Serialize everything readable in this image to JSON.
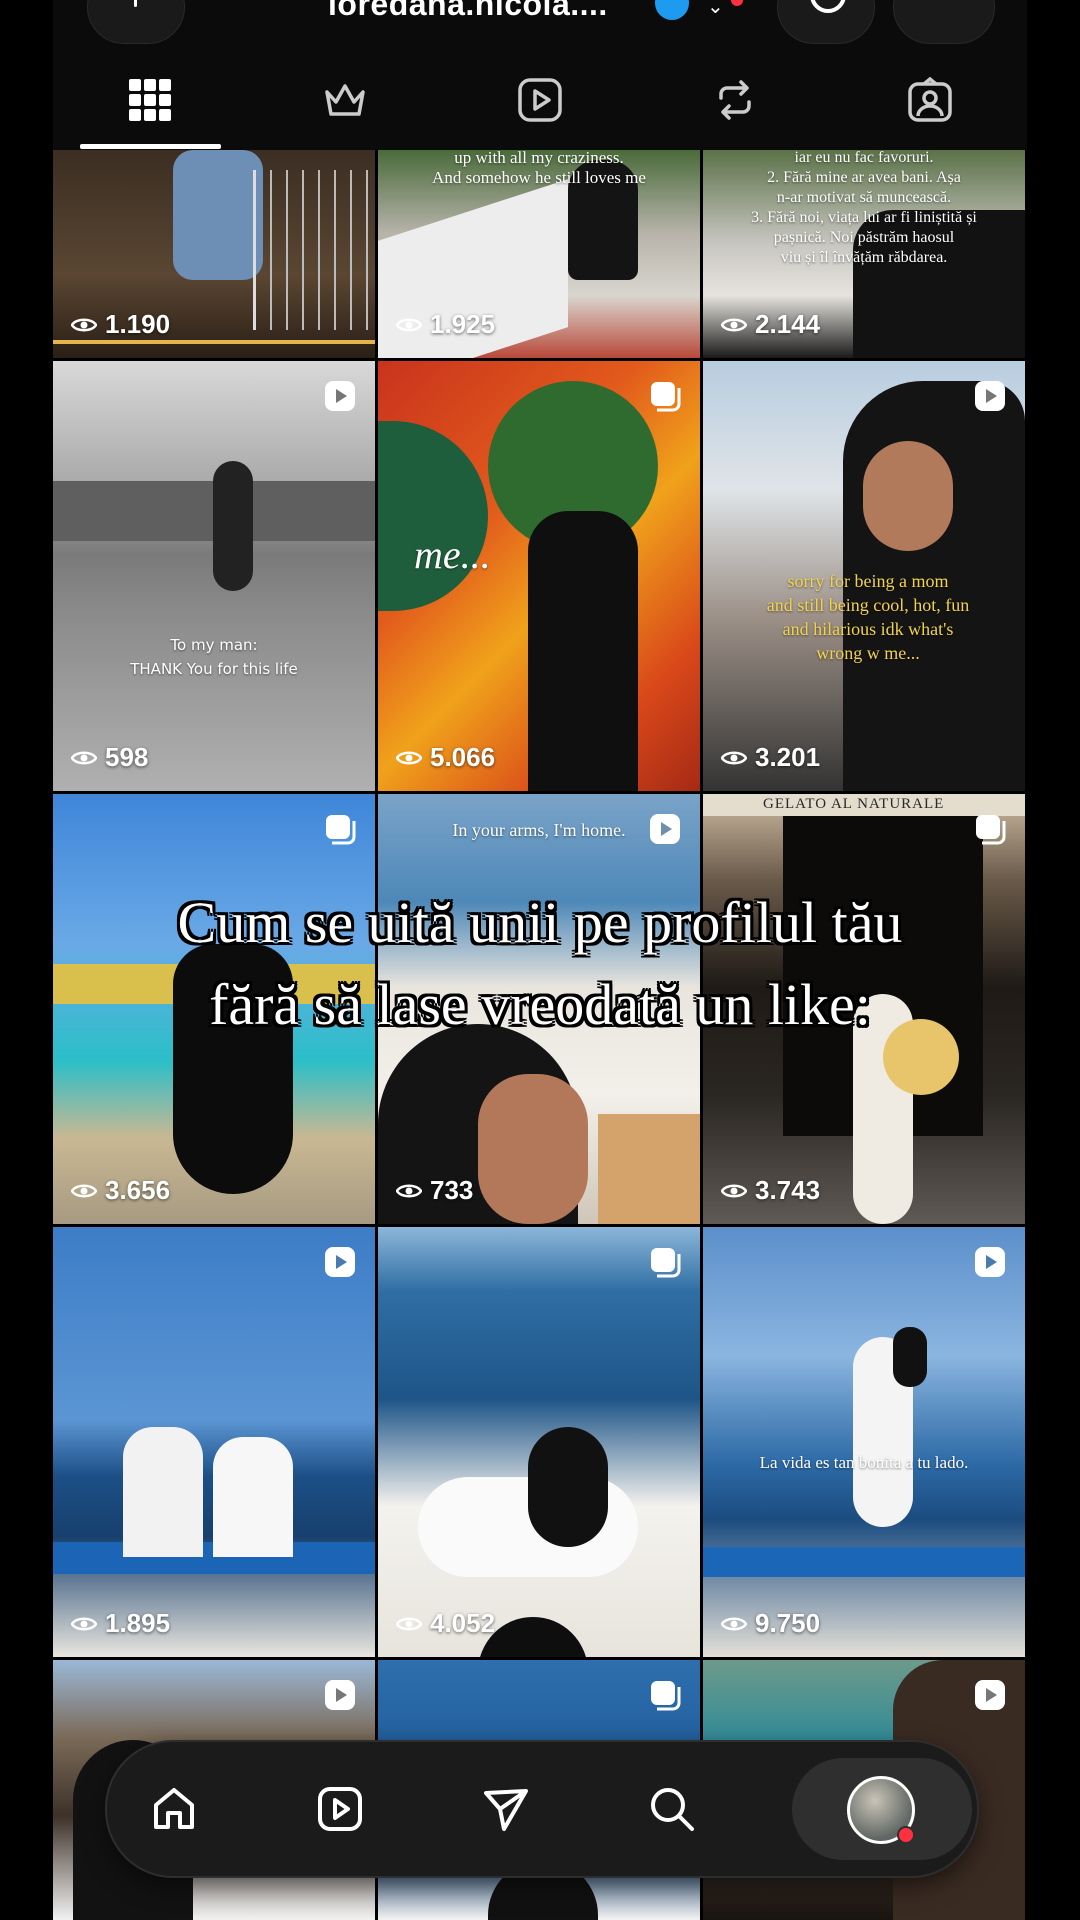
{
  "header": {
    "username": "loredana.nicola....",
    "tabs": [
      "grid",
      "subscriptions",
      "reels",
      "reposts",
      "tagged"
    ]
  },
  "overlay": {
    "line1": "Cum se uită unii pe profilul tău",
    "line2": "fără să lase vreodată un like:"
  },
  "captions": {
    "r0c1_a": "up with all my craziness.",
    "r0c1_b": "And somehow he still loves me",
    "r0c2_a": "iar eu nu fac favoruri.",
    "r0c2_b": "2. Fără mine ar avea bani. Așa",
    "r0c2_c": "n-ar motivat să muncească.",
    "r0c2_d": "3. Fără noi, viața lui ar fi liniștită și",
    "r0c2_e": "pașnică. Noi păstrăm haosul",
    "r0c2_f": "viu și îl învățăm răbdarea.",
    "r1c0_a": "To my man:",
    "r1c0_b": "THANK You for this life",
    "r1c1_a": "me...",
    "r1c2_a": "sorry for being a mom",
    "r1c2_b": "and still being cool, hot, fun",
    "r1c2_c": "and hilarious idk what's",
    "r1c2_d": "wrong w me...",
    "r2c1_a": "In your arms, I'm home.",
    "r2c2_a": "GELATO AL NATURALE",
    "r3c2_a": "La vida es tan bonita a tu lado."
  },
  "views": {
    "r0c0": "1.190",
    "r0c1": "1.925",
    "r0c2": "2.144",
    "r1c0": "598",
    "r1c1": "5.066",
    "r1c2": "3.201",
    "r2c0": "3.656",
    "r2c1": "733",
    "r2c2": "3.743",
    "r3c0": "1.895",
    "r3c1": "4.052",
    "r3c2": "9.750"
  },
  "nav": [
    "home",
    "reels",
    "messages",
    "search",
    "profile"
  ]
}
